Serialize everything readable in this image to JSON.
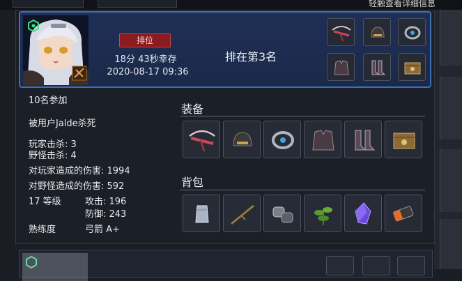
{
  "top_hint": "轻触查看详细信息",
  "header": {
    "rank_badge": "排位",
    "survive_time": "18分 43秒幸存",
    "date": "2020-08-17 09:36",
    "placement": "排在第3名"
  },
  "stats": {
    "participants": "10名参加",
    "killed_by": "被用户Jalde杀死",
    "player_kills": "玩家击杀: 3",
    "monster_kills": "野怪击杀: 4",
    "damage_to_players": "对玩家造成的伤害: 1994",
    "damage_to_monsters": "对野怪造成的伤害: 592",
    "level": "17 等级",
    "attack": "攻击: 196",
    "defense": "防御: 243",
    "proficiency_label": "熟练度",
    "proficiency_value": "弓箭 A+"
  },
  "equipment_title": "装备",
  "bag_title": "背包",
  "equipment_icons": [
    "crossbow-icon",
    "helmet-icon",
    "bracelet-icon",
    "armor-icon",
    "boots-icon",
    "accessory-box-icon"
  ],
  "bag_icons": [
    "cloth-icon",
    "branch-icon",
    "leather-icon",
    "herb-icon",
    "crystal-icon",
    "battery-icon"
  ],
  "colors": {
    "accent": "#3f6fb3",
    "rank_red": "#8c1b1f",
    "panel": "#1b1f27"
  }
}
